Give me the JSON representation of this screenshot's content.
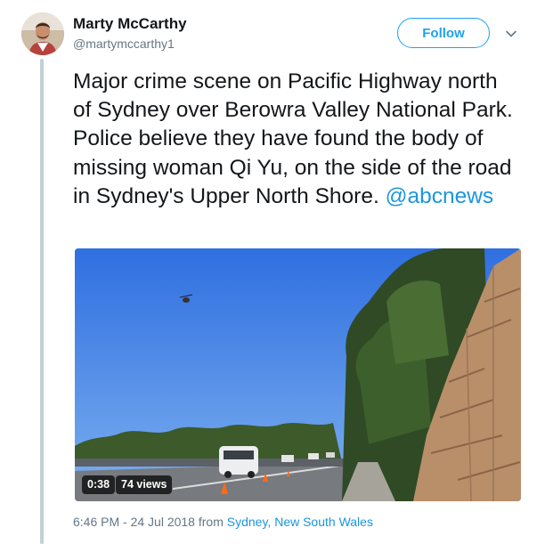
{
  "author": {
    "name": "Marty McCarthy",
    "handle": "@martymccarthy1"
  },
  "follow_label": "Follow",
  "menu_icon": "chevron-down-icon",
  "tweet": {
    "text": "Major crime scene on Pacific Highway north of Sydney over Berowra Valley National Park. Police believe they have found the body of missing woman Qi Yu, on the side of the road in Sydney's Upper North Shore.",
    "mention": "@abcnews"
  },
  "video": {
    "duration": "0:38",
    "views": "74 views"
  },
  "meta": {
    "timestamp": "6:46 PM - 24 Jul 2018",
    "from_label": "from",
    "location": "Sydney, New South Wales"
  },
  "colors": {
    "accent": "#1da1f2",
    "link": "#1b95e0",
    "secondary_text": "#657786"
  }
}
